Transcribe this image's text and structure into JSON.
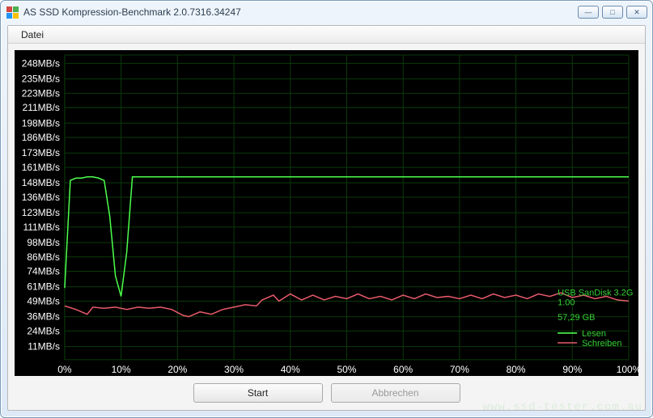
{
  "window": {
    "title": "AS SSD Kompression-Benchmark 2.0.7316.34247",
    "min_label": "—",
    "max_label": "□",
    "close_label": "✕"
  },
  "menu": {
    "file": "Datei"
  },
  "buttons": {
    "start": "Start",
    "cancel": "Abbrechen"
  },
  "info": {
    "device": "USB  SanDisk 3.2G",
    "firmware": "1.00",
    "capacity": "57,29 GB"
  },
  "legend": {
    "read": "Lesen",
    "write": "Schreiben"
  },
  "watermark": "www.ssd-tester.com.au",
  "chart_data": {
    "type": "line",
    "xlabel": "",
    "ylabel": "",
    "x_ticks_pct": [
      0,
      10,
      20,
      30,
      40,
      50,
      60,
      70,
      80,
      90,
      100
    ],
    "y_ticks_mb": [
      11,
      24,
      36,
      49,
      61,
      74,
      86,
      98,
      111,
      123,
      136,
      148,
      161,
      173,
      186,
      198,
      211,
      223,
      235,
      248
    ],
    "y_suffix": "MB/s",
    "xlim": [
      0,
      100
    ],
    "ylim": [
      0,
      255
    ],
    "series": [
      {
        "name": "Lesen",
        "color": "#4cff4c",
        "x": [
          0,
          1,
          2,
          3,
          4,
          5,
          6,
          7,
          8,
          9,
          10,
          11,
          12,
          100
        ],
        "values": [
          60,
          150,
          152,
          152,
          153,
          153,
          152,
          150,
          120,
          70,
          53,
          90,
          153,
          153
        ]
      },
      {
        "name": "Schreiben",
        "color": "#e85a6a",
        "x": [
          0,
          2,
          4,
          5,
          7,
          9,
          11,
          13,
          15,
          17,
          19,
          21,
          22,
          24,
          26,
          28,
          30,
          32,
          34,
          35,
          37,
          38,
          40,
          42,
          44,
          46,
          48,
          50,
          52,
          54,
          56,
          58,
          60,
          62,
          64,
          66,
          68,
          70,
          72,
          74,
          76,
          78,
          80,
          82,
          84,
          86,
          88,
          90,
          92,
          94,
          96,
          98,
          100
        ],
        "values": [
          45,
          42,
          38,
          44,
          43,
          44,
          42,
          44,
          43,
          44,
          42,
          37,
          36,
          40,
          38,
          42,
          44,
          46,
          45,
          50,
          54,
          49,
          55,
          50,
          54,
          50,
          53,
          51,
          55,
          51,
          53,
          50,
          54,
          51,
          55,
          52,
          53,
          51,
          54,
          51,
          55,
          52,
          54,
          51,
          55,
          53,
          56,
          52,
          54,
          51,
          53,
          50,
          49
        ]
      }
    ]
  }
}
